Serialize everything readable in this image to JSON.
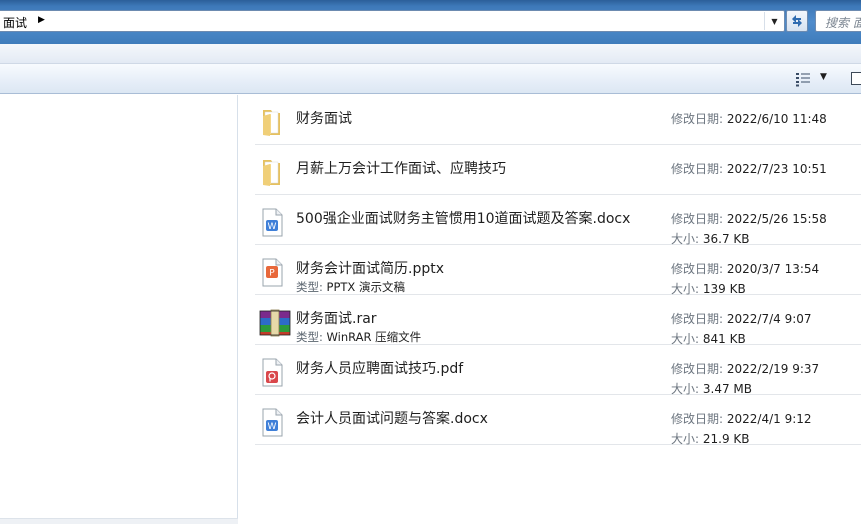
{
  "address_bar": {
    "path_segment": "面试",
    "separator_icon": "triangle-right-icon",
    "dropdown_icon": "chevron-down-icon",
    "refresh_icon": "refresh-icon"
  },
  "search": {
    "placeholder": "搜索 面"
  },
  "toolbar": {
    "view_icon": "details-view-icon",
    "view_dropdown_icon": "chevron-down-icon",
    "preview_icon": "preview-pane-icon"
  },
  "labels": {
    "modified": "修改日期:",
    "size": "大小:",
    "type": "类型:"
  },
  "files": [
    {
      "name": "财务面试",
      "icon": "folder-icon",
      "modified": "2022/6/10 11:48"
    },
    {
      "name": "月薪上万会计工作面试、应聘技巧",
      "icon": "folder-icon",
      "modified": "2022/7/23 10:51"
    },
    {
      "name": "500强企业面试财务主管惯用10道面试题及答案.docx",
      "icon": "word-doc-icon",
      "modified": "2022/5/26 15:58",
      "size": "36.7 KB"
    },
    {
      "name": "财务会计面试简历.pptx",
      "icon": "ppt-doc-icon",
      "type": "PPTX 演示文稿",
      "modified": "2020/3/7 13:54",
      "size": "139 KB"
    },
    {
      "name": "财务面试.rar",
      "icon": "rar-archive-icon",
      "type": "WinRAR 压缩文件",
      "modified": "2022/7/4 9:07",
      "size": "841 KB"
    },
    {
      "name": "财务人员应聘面试技巧.pdf",
      "icon": "pdf-doc-icon",
      "modified": "2022/2/19 9:37",
      "size": "3.47 MB"
    },
    {
      "name": "会计人员面试问题与答案.docx",
      "icon": "word-doc-icon",
      "modified": "2022/4/1 9:12",
      "size": "21.9 KB"
    }
  ],
  "colors": {
    "title_blue": "#3d78b8",
    "word_blue": "#3f7fd8",
    "ppt_orange": "#e8683b",
    "pdf_red": "#d9474b",
    "folder_yellow": "#e9c66a"
  }
}
